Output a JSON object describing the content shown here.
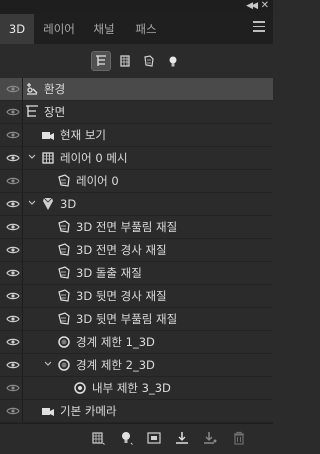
{
  "tabs": [
    {
      "label": "3D",
      "active": true
    },
    {
      "label": "레이어",
      "active": false
    },
    {
      "label": "채널",
      "active": false
    },
    {
      "label": "패스",
      "active": false
    }
  ],
  "window": {
    "collapse_glyph": "◀◀",
    "close_glyph": "✕"
  },
  "filters": [
    "scene-filter-icon",
    "mesh-filter-icon",
    "material-filter-icon",
    "light-filter-icon"
  ],
  "rows": [
    {
      "label": "환경"
    },
    {
      "label": "장면"
    },
    {
      "label": "현재 보기"
    },
    {
      "label": "레이어 0 메시"
    },
    {
      "label": "레이어 0"
    },
    {
      "label": "3D"
    },
    {
      "label": "3D 전면 부풀림 재질"
    },
    {
      "label": "3D 전면 경사 재질"
    },
    {
      "label": "3D 돌출 재질"
    },
    {
      "label": "3D 뒷면 경사 재질"
    },
    {
      "label": "3D 뒷면 부풀림 재질"
    },
    {
      "label": "경계 제한 1_3D"
    },
    {
      "label": "경계 제한 2_3D"
    },
    {
      "label": "내부 제한 3_3D"
    },
    {
      "label": "기본 카메라"
    }
  ],
  "colors": {
    "panel": "#2b2b2b",
    "tabbar": "#1f1f1f",
    "selected_row": "#4a4a4a",
    "text": "#dcdcdc"
  }
}
